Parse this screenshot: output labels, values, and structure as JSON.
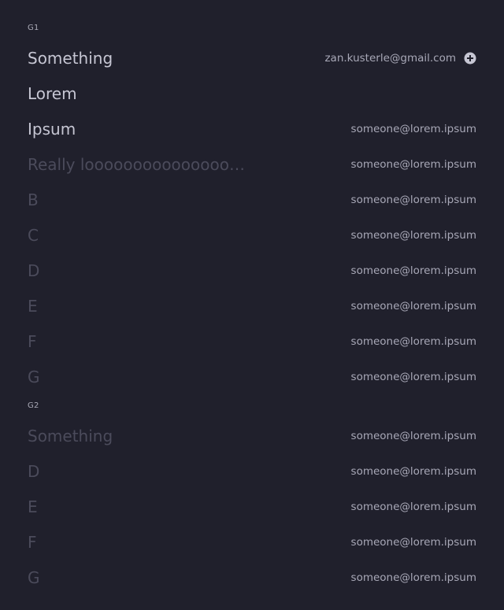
{
  "groups": [
    {
      "label": "G1",
      "items": [
        {
          "name": "Something",
          "email": "zan.kusterle@gmail.com",
          "active": true,
          "add": true
        },
        {
          "name": "Lorem",
          "email": "",
          "active": true
        },
        {
          "name": "Ipsum",
          "email": "someone@lorem.ipsum",
          "active": true
        },
        {
          "name": "Really looooooooooooooooooooooong",
          "email": "someone@lorem.ipsum",
          "active": false
        },
        {
          "name": "B",
          "email": "someone@lorem.ipsum",
          "active": false
        },
        {
          "name": "C",
          "email": "someone@lorem.ipsum",
          "active": false
        },
        {
          "name": "D",
          "email": "someone@lorem.ipsum",
          "active": false
        },
        {
          "name": "E",
          "email": "someone@lorem.ipsum",
          "active": false
        },
        {
          "name": "F",
          "email": "someone@lorem.ipsum",
          "active": false
        },
        {
          "name": "G",
          "email": "someone@lorem.ipsum",
          "active": false
        }
      ]
    },
    {
      "label": "G2",
      "items": [
        {
          "name": "Something",
          "email": "someone@lorem.ipsum",
          "active": false
        },
        {
          "name": "D",
          "email": "someone@lorem.ipsum",
          "active": false
        },
        {
          "name": "E",
          "email": "someone@lorem.ipsum",
          "active": false
        },
        {
          "name": "F",
          "email": "someone@lorem.ipsum",
          "active": false
        },
        {
          "name": "G",
          "email": "someone@lorem.ipsum",
          "active": false
        }
      ]
    }
  ],
  "icons": {
    "add": "plus-circle-icon"
  },
  "colors": {
    "background": "#20202c",
    "active_text": "#c6c6d3",
    "inactive_text": "#4b4b5b",
    "email_text": "#a8a8b7"
  }
}
